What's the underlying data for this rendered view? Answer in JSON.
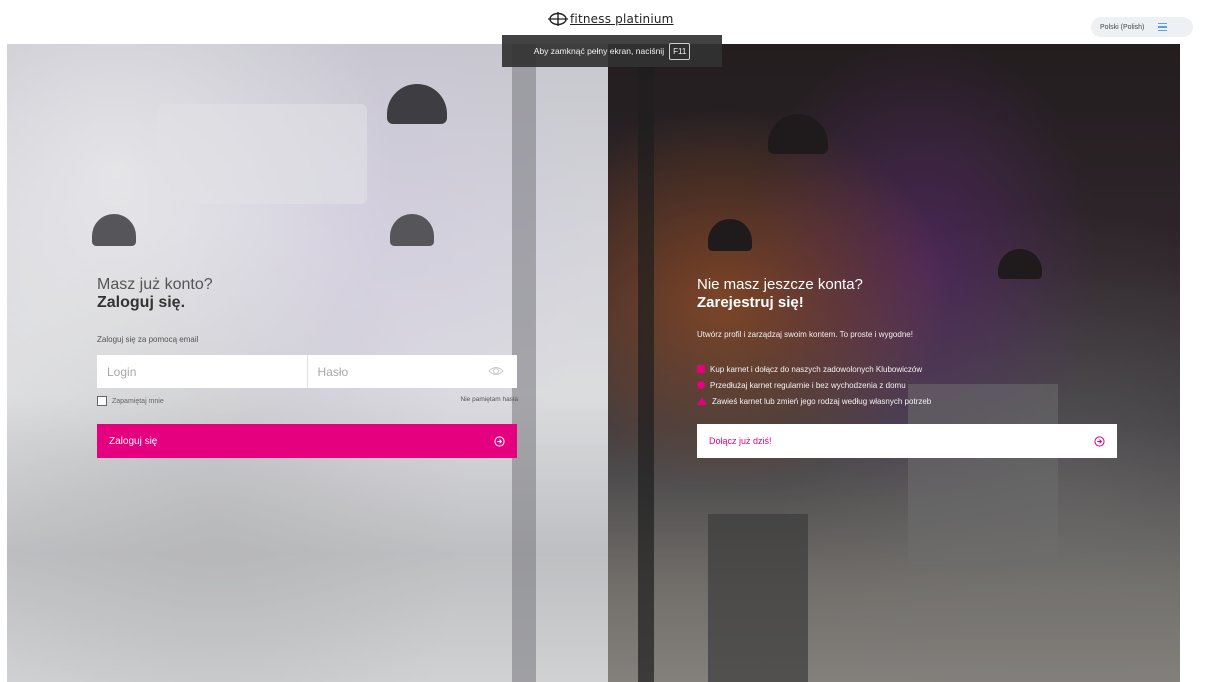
{
  "header": {
    "logo_text": "fitness platinium",
    "language": "Polski (Polish)"
  },
  "fullscreen_toast": {
    "message": "Aby zamknąć pełny ekran, naciśnij",
    "key": "F11"
  },
  "login": {
    "heading_line1": "Masz już konto?",
    "heading_line2": "Zaloguj się.",
    "subtitle": "Zaloguj się za pomocą email",
    "login_placeholder": "Login",
    "password_placeholder": "Hasło",
    "remember_label": "Zapamiętaj mnie",
    "forgot_label": "Nie pamiętam hasła",
    "submit_label": "Zaloguj się"
  },
  "register": {
    "heading_line1": "Nie masz jeszcze konta?",
    "heading_line2": "Zarejestruj się!",
    "subtitle": "Utwórz profil i zarządzaj swoim kontem. To proste i wygodne!",
    "benefits": [
      "Kup karnet i dołącz do naszych zadowolonych Klubowiczów",
      "Przedłużaj karnet regularnie i bez wychodzenia z domu",
      "Zawieś karnet lub zmień jego rodzaj według własnych potrzeb"
    ],
    "join_label": "Dołącz już dziś!"
  },
  "colors": {
    "accent": "#e4007f",
    "menu_icon": "#5aa0e6"
  },
  "icons": {
    "menu": "hamburger-icon",
    "eye": "eye-icon",
    "arrow": "circle-arrow-right-icon"
  }
}
